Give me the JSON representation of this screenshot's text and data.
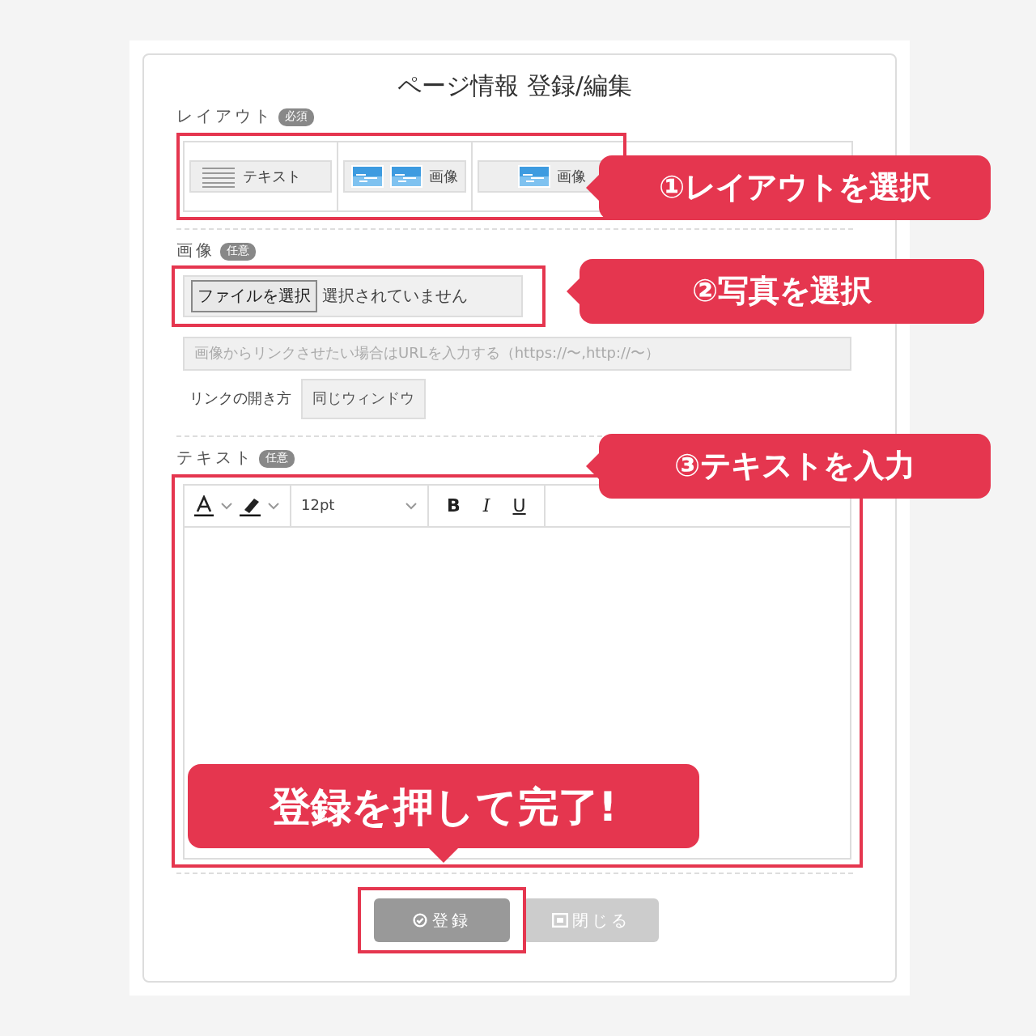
{
  "title": "ページ情報 登録/編集",
  "layout": {
    "label": "レイアウト",
    "badge": "必須",
    "options": [
      {
        "kind": "text",
        "label": "テキスト"
      },
      {
        "kind": "two_images",
        "label": "画像"
      },
      {
        "kind": "one_image",
        "label": "画像"
      }
    ]
  },
  "image": {
    "label": "画像",
    "badge": "任意",
    "file_button": "ファイルを選択",
    "file_status": "選択されていません",
    "url_placeholder": "画像からリンクさせたい場合はURLを入力する（https://〜,http://〜）",
    "link_label": "リンクの開き方",
    "link_value": "同じウィンドウ"
  },
  "text": {
    "label": "テキスト",
    "badge": "任意",
    "font_size": "12pt",
    "format_buttons": [
      "B",
      "I",
      "U"
    ]
  },
  "buttons": [
    {
      "label": "登録",
      "disabled": false
    },
    {
      "label": "閉じる",
      "disabled": true
    }
  ],
  "callouts": [
    {
      "text": "①レイアウトを選択"
    },
    {
      "text": "②写真を選択"
    },
    {
      "text": "③テキストを入力"
    }
  ],
  "final_callout": "登録を押して完了!"
}
